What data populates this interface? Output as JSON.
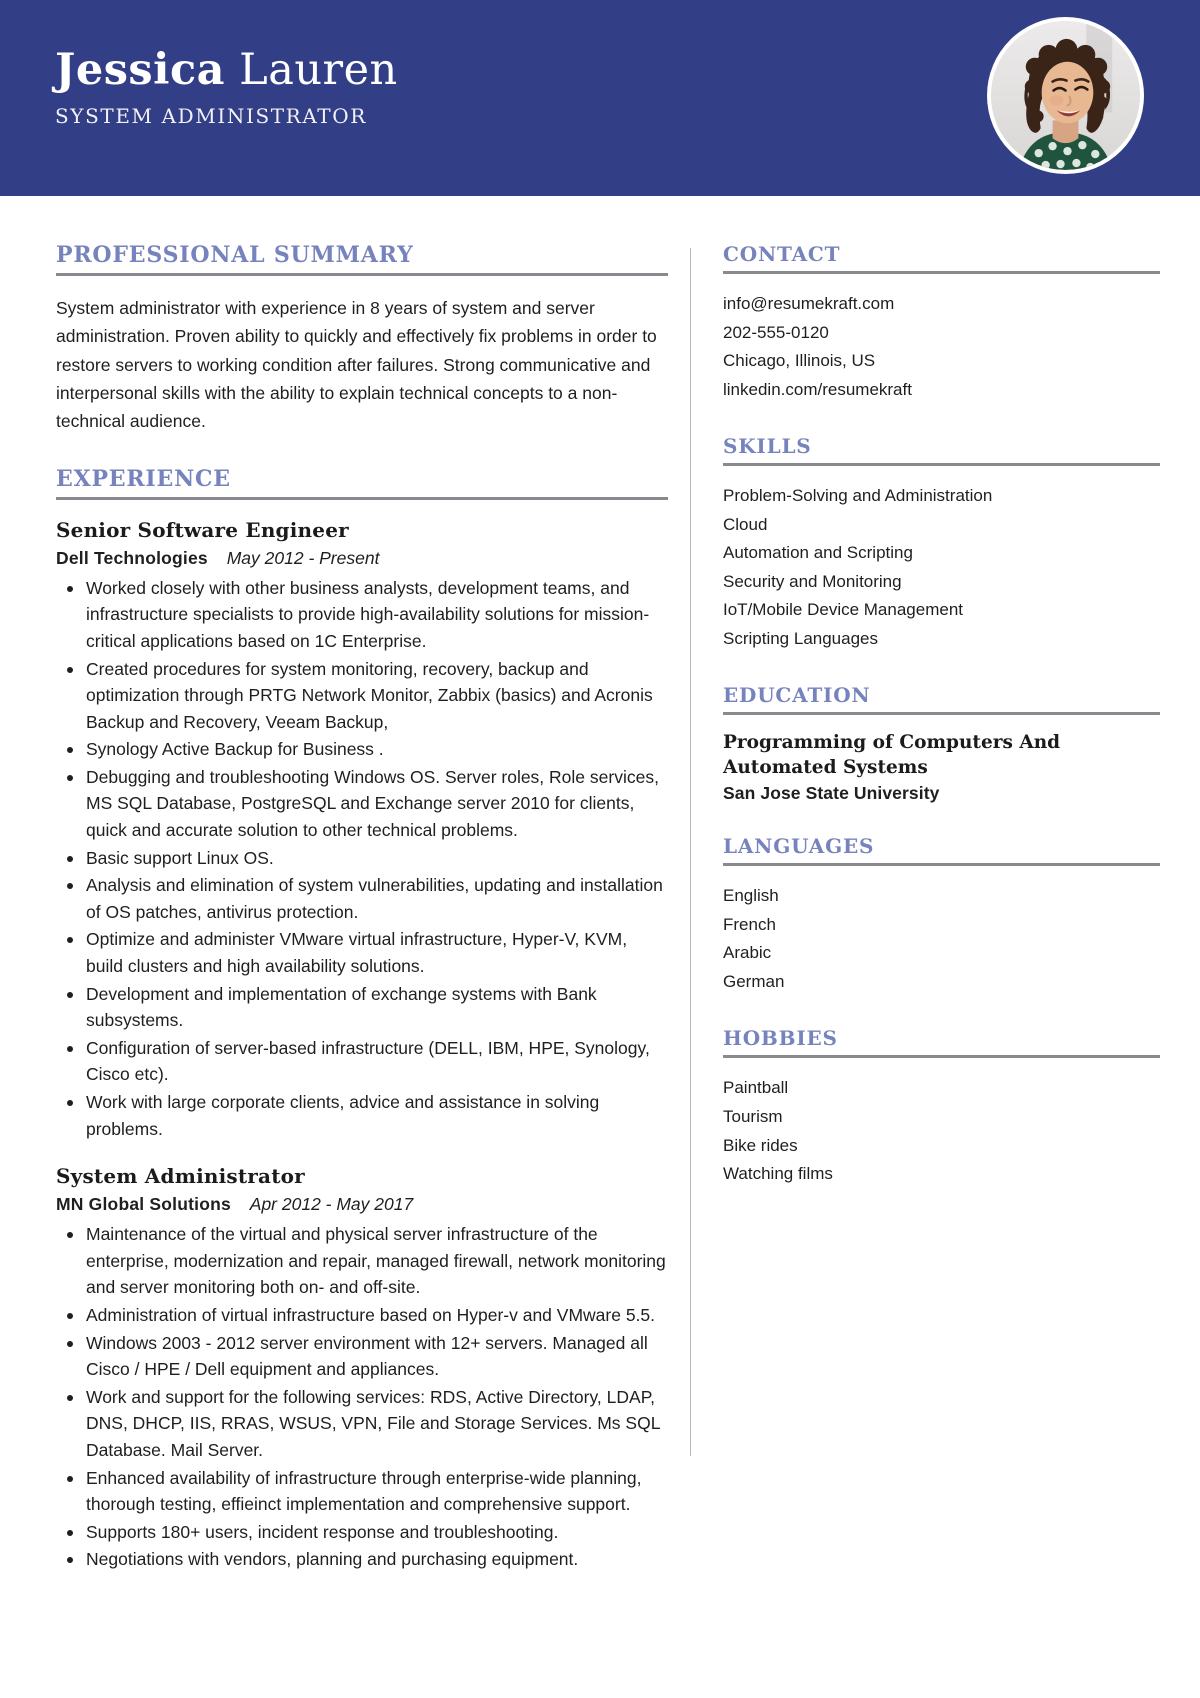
{
  "colors": {
    "header_bg": "#323f87",
    "heading_blue": "#7683bd",
    "rule_gray": "#888a90",
    "text": "#1f1f1f"
  },
  "header": {
    "first_name": "Jessica",
    "last_name": "Lauren",
    "job_title": "SYSTEM ADMINISTRATOR",
    "photo_alt": "profile-photo"
  },
  "left": {
    "summary": {
      "heading": "PROFESSIONAL SUMMARY",
      "text": "System administrator with experience in 8 years of system and server administration. Proven ability to quickly and effectively fix problems in order to restore servers to working condition after failures. Strong communicative and interpersonal skills with the ability to explain technical concepts to a non-technical audience."
    },
    "experience": {
      "heading": "EXPERIENCE",
      "jobs": [
        {
          "role": "Senior Software Engineer",
          "company": "Dell Technologies",
          "dates": "May 2012 - Present",
          "bullets": [
            "Worked closely with other business analysts, development teams, and infrastructure specialists to provide high-availability solutions for mission-critical applications based on 1C Enterprise.",
            "Created procedures for system monitoring, recovery, backup and optimization through PRTG Network Monitor, Zabbix (basics) and Acronis Backup and Recovery, Veeam Backup,",
            "Synology Active Backup for Business .",
            "Debugging and troubleshooting Windows OS. Server roles, Role services, MS SQL Database, PostgreSQL and Exchange server 2010 for clients, quick and accurate solution to other technical problems.",
            "Basic support Linux OS.",
            "Analysis and elimination of system vulnerabilities, updating and installation of OS patches, antivirus protection.",
            "Optimize and administer VMware virtual infrastructure, Hyper-V, KVM, build clusters and high availability solutions.",
            "Development and implementation of exchange systems with Bank subsystems.",
            "Configuration of server-based infrastructure (DELL, IBM, HPE, Synology, Cisco etc).",
            "Work with large corporate clients, advice and assistance in solving problems."
          ]
        },
        {
          "role": "System Administrator",
          "company": "MN Global Solutions",
          "dates": "Apr 2012 - May 2017",
          "bullets": [
            "Maintenance of the virtual and physical server infrastructure of the enterprise, modernization and repair, managed firewall, network monitoring and server monitoring both on- and off-site.",
            "Administration of virtual infrastructure based on Hyper-v and VMware 5.5.",
            "Windows 2003 - 2012 server environment with 12+ servers. Managed all Cisco / HPE / Dell equipment and appliances.",
            "Work and support for the following services: RDS, Active Directory, LDAP, DNS, DHCP, IIS, RRAS, WSUS, VPN, File and Storage Services. Ms SQL Database. Mail Server.",
            "Enhanced availability of infrastructure through enterprise-wide planning, thorough testing, effieinct implementation and comprehensive support.",
            "Supports 180+ users, incident response and troubleshooting.",
            "Negotiations with vendors, planning and purchasing equipment."
          ]
        }
      ]
    }
  },
  "right": {
    "contact": {
      "heading": "CONTACT",
      "items": [
        "info@resumekraft.com",
        "202-555-0120",
        "Chicago, Illinois, US",
        "linkedin.com/resumekraft"
      ]
    },
    "skills": {
      "heading": "SKILLS",
      "items": [
        "Problem-Solving and Administration",
        "Cloud",
        "Automation and Scripting",
        "Security and Monitoring",
        "IoT/Mobile Device Management",
        "Scripting Languages"
      ]
    },
    "education": {
      "heading": "EDUCATION",
      "degree": "Programming of Computers And Automated Systems",
      "school": "San Jose State University"
    },
    "languages": {
      "heading": "LANGUAGES",
      "items": [
        "English",
        "French",
        "Arabic",
        "German"
      ]
    },
    "hobbies": {
      "heading": "HOBBIES",
      "items": [
        "Paintball",
        "Tourism",
        "Bike rides",
        "Watching films"
      ]
    }
  }
}
